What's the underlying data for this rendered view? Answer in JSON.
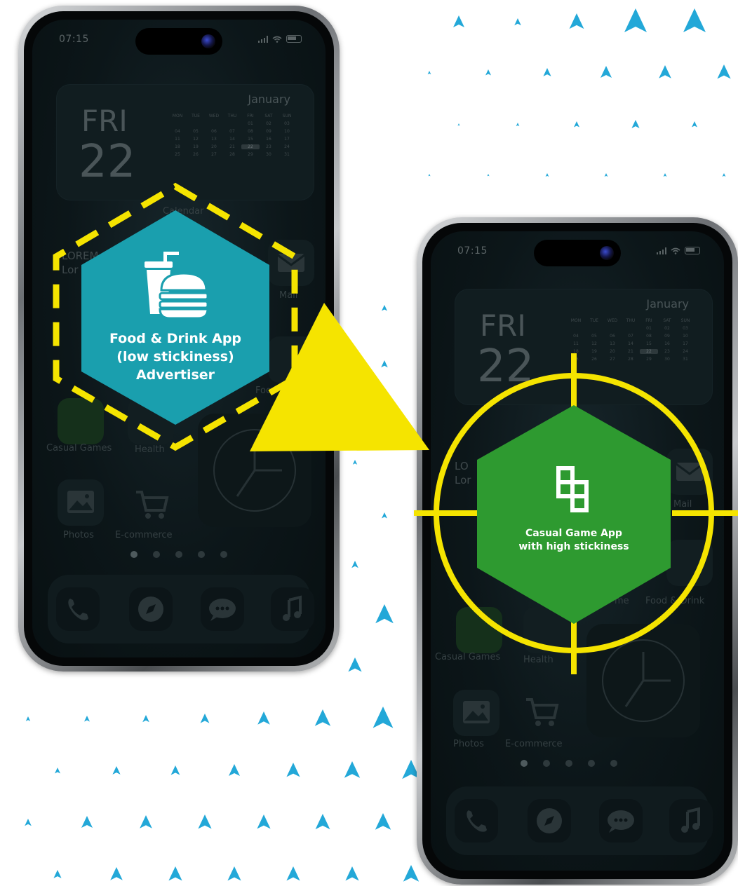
{
  "left_phone": {
    "status_time": "07:15",
    "calendar": {
      "day_name": "FRI",
      "day_number": "22",
      "month": "January",
      "weekdays": [
        "MON",
        "TUE",
        "WED",
        "THU",
        "FRI",
        "SAT",
        "SUN"
      ],
      "rows": [
        [
          "",
          "",
          "",
          "",
          "01",
          "02",
          "03"
        ],
        [
          "04",
          "05",
          "06",
          "07",
          "08",
          "09",
          "10"
        ],
        [
          "11",
          "12",
          "13",
          "14",
          "15",
          "16",
          "17"
        ],
        [
          "18",
          "19",
          "20",
          "21",
          "22",
          "23",
          "24"
        ],
        [
          "25",
          "26",
          "27",
          "28",
          "29",
          "30",
          "31"
        ]
      ],
      "label": "Calendar"
    },
    "apps": {
      "casual_games": "Casual Games",
      "health": "Health",
      "photos": "Photos",
      "ecommerce": "E-commerce",
      "mail": "Mail",
      "food_drink": "Food & Drink",
      "lorem": "LOREM",
      "lorem_sub": "Lor"
    }
  },
  "right_phone": {
    "status_time": "07:15",
    "calendar": {
      "day_name": "FRI",
      "day_number": "22",
      "month": "January"
    },
    "apps": {
      "casual_games": "Casual Games",
      "health": "Health",
      "photos": "Photos",
      "ecommerce": "E-commerce",
      "mail": "Mail",
      "food_drink": "Food & Drink",
      "game": "me",
      "lorem": "LO",
      "lorem_sub": "Lor"
    }
  },
  "advertiser_badge": {
    "line1": "Food & Drink App",
    "line2": "(low stickiness)",
    "line3": "Advertiser",
    "color": "#1a9fae",
    "border_color": "#f5e400",
    "icon": "drink-burger-icon"
  },
  "target_badge": {
    "line1": "Casual Game App",
    "line2": "with high stickiness",
    "color": "#2e9a30",
    "crosshair_color": "#f5e400",
    "icon": "game-blocks-icon"
  },
  "colors": {
    "arrow_pattern": "#23a8d8",
    "pointer": "#f5e400"
  },
  "dock_icons": [
    "phone-icon",
    "compass-icon",
    "messages-icon",
    "music-icon"
  ]
}
